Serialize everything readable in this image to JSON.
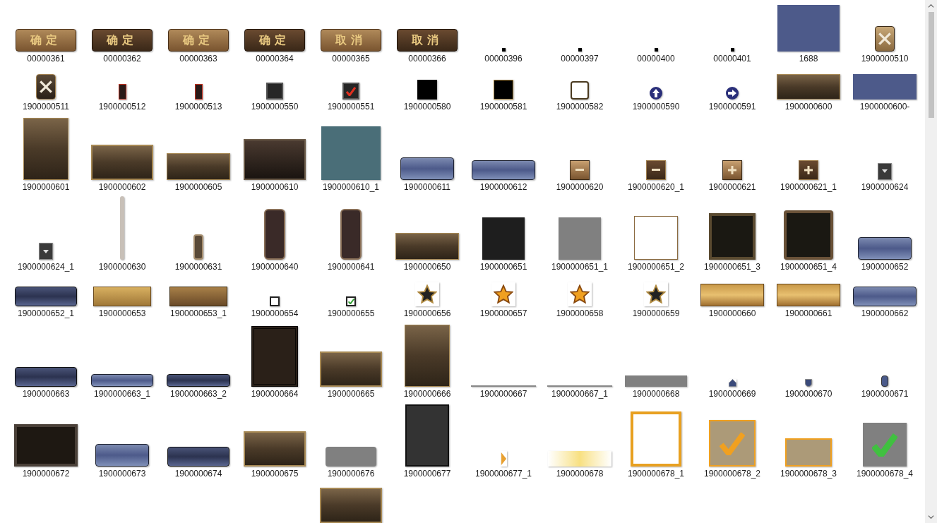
{
  "rows": [
    {
      "items": [
        {
          "name": "00000361",
          "kind": "btn-light",
          "text": "确定"
        },
        {
          "name": "00000362",
          "kind": "btn-dark",
          "text": "确定"
        },
        {
          "name": "00000363",
          "kind": "btn-light",
          "text": "确定"
        },
        {
          "name": "00000364",
          "kind": "btn-dark",
          "text": "确定"
        },
        {
          "name": "00000365",
          "kind": "btn-light",
          "text": "取消"
        },
        {
          "name": "00000366",
          "kind": "btn-dark",
          "text": "取消"
        },
        {
          "name": "00000396",
          "kind": "dot"
        },
        {
          "name": "00000397",
          "kind": "dot"
        },
        {
          "name": "00000400",
          "kind": "dot"
        },
        {
          "name": "00000401",
          "kind": "dot"
        },
        {
          "name": "1688",
          "kind": "blue-rect"
        },
        {
          "name": "1900000510",
          "kind": "close-light"
        }
      ]
    },
    {
      "items": [
        {
          "name": "1900000511",
          "kind": "close-dark"
        },
        {
          "name": "1900000512",
          "kind": "red-x"
        },
        {
          "name": "1900000513",
          "kind": "red-x"
        },
        {
          "name": "1900000550",
          "kind": "checkbox-dark"
        },
        {
          "name": "1900000551",
          "kind": "checkbox-dark-checked"
        },
        {
          "name": "1900000580",
          "kind": "black-square"
        },
        {
          "name": "1900000581",
          "kind": "black-square-gold"
        },
        {
          "name": "1900000582",
          "kind": "white-frame"
        },
        {
          "name": "1900000590",
          "kind": "circle-up"
        },
        {
          "name": "1900000591",
          "kind": "circle-right"
        },
        {
          "name": "1900000600",
          "kind": "panel-wide"
        },
        {
          "name": "1900000600-",
          "kind": "blue-bar"
        }
      ]
    },
    {
      "items": [
        {
          "name": "1900000601",
          "kind": "panel-tall"
        },
        {
          "name": "1900000602",
          "kind": "panel-frame"
        },
        {
          "name": "1900000605",
          "kind": "panel-low"
        },
        {
          "name": "1900000610",
          "kind": "panel-dark"
        },
        {
          "name": "1900000610_1",
          "kind": "teal-rect"
        },
        {
          "name": "1900000611",
          "kind": "blue-button"
        },
        {
          "name": "1900000612",
          "kind": "blue-button-wide"
        },
        {
          "name": "1900000620",
          "kind": "minus-light"
        },
        {
          "name": "1900000620_1",
          "kind": "minus-dark"
        },
        {
          "name": "1900000621",
          "kind": "plus-light"
        },
        {
          "name": "1900000621_1",
          "kind": "plus-dark"
        },
        {
          "name": "1900000624",
          "kind": "down-box"
        }
      ]
    },
    {
      "items": [
        {
          "name": "1900000624_1",
          "kind": "down-box"
        },
        {
          "name": "1900000630",
          "kind": "scroll-track"
        },
        {
          "name": "1900000631",
          "kind": "scroll-thumb"
        },
        {
          "name": "1900000640",
          "kind": "slot"
        },
        {
          "name": "1900000641",
          "kind": "slot"
        },
        {
          "name": "1900000650",
          "kind": "panel-low"
        },
        {
          "name": "1900000651",
          "kind": "dark-square"
        },
        {
          "name": "1900000651_1",
          "kind": "grey-square"
        },
        {
          "name": "1900000651_2",
          "kind": "white-square"
        },
        {
          "name": "1900000651_3",
          "kind": "ornate-frame"
        },
        {
          "name": "1900000651_4",
          "kind": "ornate-frame-red"
        },
        {
          "name": "1900000652",
          "kind": "blue-button"
        }
      ]
    },
    {
      "items": [
        {
          "name": "1900000652_1",
          "kind": "blue-button-dark"
        },
        {
          "name": "1900000653",
          "kind": "gold-button"
        },
        {
          "name": "1900000653_1",
          "kind": "gold-button-dark"
        },
        {
          "name": "1900000654",
          "kind": "checkbox-empty"
        },
        {
          "name": "1900000655",
          "kind": "checkbox-green"
        },
        {
          "name": "1900000656",
          "kind": "star-dark"
        },
        {
          "name": "1900000657",
          "kind": "star-gold"
        },
        {
          "name": "1900000658",
          "kind": "star-badge"
        },
        {
          "name": "1900000659",
          "kind": "star-badge-dark"
        },
        {
          "name": "1900000660",
          "kind": "gold-bar"
        },
        {
          "name": "1900000661",
          "kind": "gold-bar"
        },
        {
          "name": "1900000662",
          "kind": "blue-button-wide"
        }
      ]
    },
    {
      "items": [
        {
          "name": "1900000663",
          "kind": "blue-button-dark"
        },
        {
          "name": "1900000663_1",
          "kind": "blue-thin"
        },
        {
          "name": "1900000663_2",
          "kind": "blue-thin-dark"
        },
        {
          "name": "1900000664",
          "kind": "leather-frame"
        },
        {
          "name": "1900000665",
          "kind": "panel-frame"
        },
        {
          "name": "1900000666",
          "kind": "panel-tall"
        },
        {
          "name": "1900000667",
          "kind": "thin-line"
        },
        {
          "name": "1900000667_1",
          "kind": "thin-line"
        },
        {
          "name": "1900000668",
          "kind": "grey-bar"
        },
        {
          "name": "1900000669",
          "kind": "house-small"
        },
        {
          "name": "1900000670",
          "kind": "shield-small"
        },
        {
          "name": "1900000671",
          "kind": "phone-small"
        }
      ]
    },
    {
      "items": [
        {
          "name": "1900000672",
          "kind": "cabinet"
        },
        {
          "name": "1900000673",
          "kind": "blue-button"
        },
        {
          "name": "1900000674",
          "kind": "blue-button-dark"
        },
        {
          "name": "1900000675",
          "kind": "panel-frame"
        },
        {
          "name": "1900000676",
          "kind": "grey-rounded"
        },
        {
          "name": "1900000677",
          "kind": "dark-tall"
        },
        {
          "name": "1900000677_1",
          "kind": "play-small"
        },
        {
          "name": "1900000678",
          "kind": "glow"
        },
        {
          "name": "1900000678_1",
          "kind": "gold-frame"
        },
        {
          "name": "1900000678_2",
          "kind": "tan-check"
        },
        {
          "name": "1900000678_3",
          "kind": "tan-rect"
        },
        {
          "name": "1900000678_4",
          "kind": "grey-check"
        }
      ]
    },
    {
      "items": [
        {
          "kind": "panel-frame"
        }
      ]
    }
  ]
}
